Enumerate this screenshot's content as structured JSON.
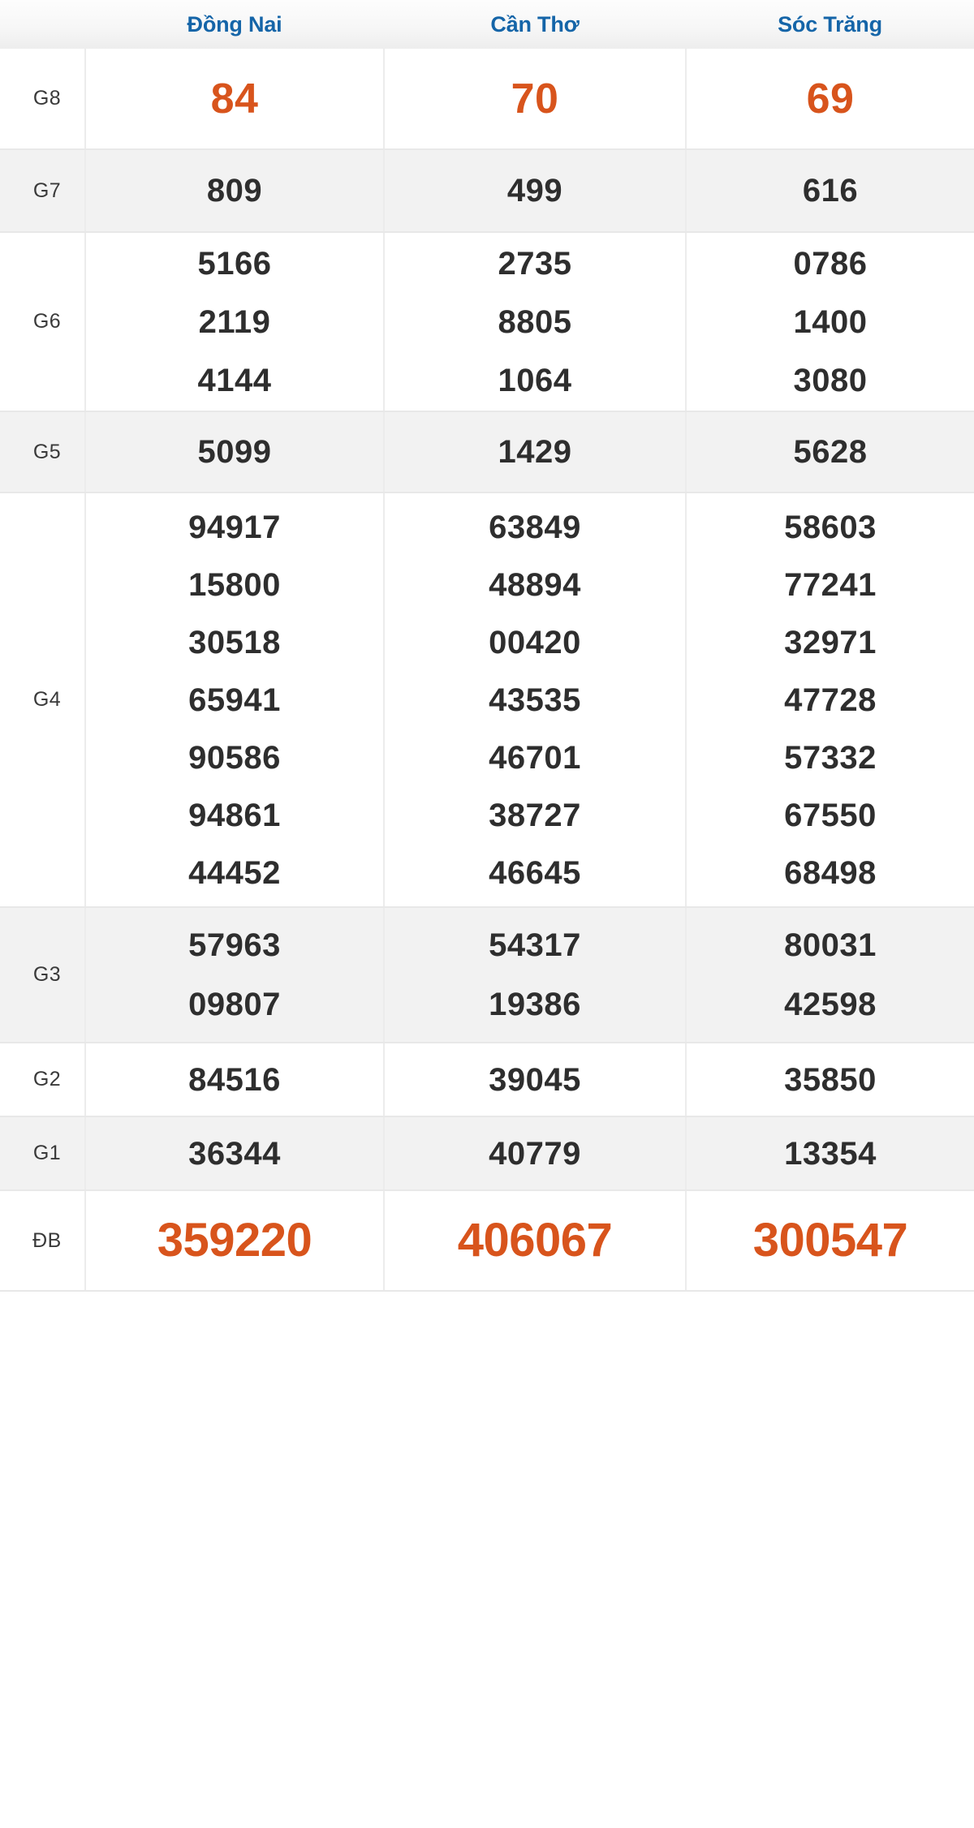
{
  "header": {
    "row_label_header": "",
    "provinces": [
      "Đồng Nai",
      "Cần Thơ",
      "Sóc Trăng"
    ]
  },
  "colors": {
    "province_blue": "#1565a8",
    "highlight_orange": "#d8541c",
    "number_dark": "#2e2e2e",
    "row_gray": "#f2f2f2",
    "row_white": "#ffffff",
    "border_gray": "#ececec"
  },
  "table": {
    "prize_rows": [
      {
        "label": "G8",
        "style": "orange-large",
        "background": "white",
        "values": {
          "dong_nai": [
            "84"
          ],
          "can_tho": [
            "70"
          ],
          "soc_trang": [
            "69"
          ]
        }
      },
      {
        "label": "G7",
        "style": "normal",
        "background": "gray",
        "values": {
          "dong_nai": [
            "809"
          ],
          "can_tho": [
            "499"
          ],
          "soc_trang": [
            "616"
          ]
        }
      },
      {
        "label": "G6",
        "style": "normal",
        "background": "white",
        "values": {
          "dong_nai": [
            "5166",
            "2119",
            "4144"
          ],
          "can_tho": [
            "2735",
            "8805",
            "1064"
          ],
          "soc_trang": [
            "0786",
            "1400",
            "3080"
          ]
        }
      },
      {
        "label": "G5",
        "style": "normal",
        "background": "gray",
        "values": {
          "dong_nai": [
            "5099"
          ],
          "can_tho": [
            "1429"
          ],
          "soc_trang": [
            "5628"
          ]
        }
      },
      {
        "label": "G4",
        "style": "normal",
        "background": "white",
        "values": {
          "dong_nai": [
            "94917",
            "15800",
            "30518",
            "65941",
            "90586",
            "94861",
            "44452"
          ],
          "can_tho": [
            "63849",
            "48894",
            "00420",
            "43535",
            "46701",
            "38727",
            "46645"
          ],
          "soc_trang": [
            "58603",
            "77241",
            "32971",
            "47728",
            "57332",
            "67550",
            "68498"
          ]
        }
      },
      {
        "label": "G3",
        "style": "normal",
        "background": "gray",
        "values": {
          "dong_nai": [
            "57963",
            "09807"
          ],
          "can_tho": [
            "54317",
            "19386"
          ],
          "soc_trang": [
            "80031",
            "42598"
          ]
        }
      },
      {
        "label": "G2",
        "style": "normal",
        "background": "white",
        "values": {
          "dong_nai": [
            "84516"
          ],
          "can_tho": [
            "39045"
          ],
          "soc_trang": [
            "35850"
          ]
        }
      },
      {
        "label": "G1",
        "style": "normal",
        "background": "gray",
        "values": {
          "dong_nai": [
            "36344"
          ],
          "can_tho": [
            "40779"
          ],
          "soc_trang": [
            "13354"
          ]
        }
      },
      {
        "label": "ĐB",
        "style": "orange-xlarge",
        "background": "white",
        "values": {
          "dong_nai": [
            "359220"
          ],
          "can_tho": [
            "406067"
          ],
          "soc_trang": [
            "300547"
          ]
        }
      }
    ]
  }
}
